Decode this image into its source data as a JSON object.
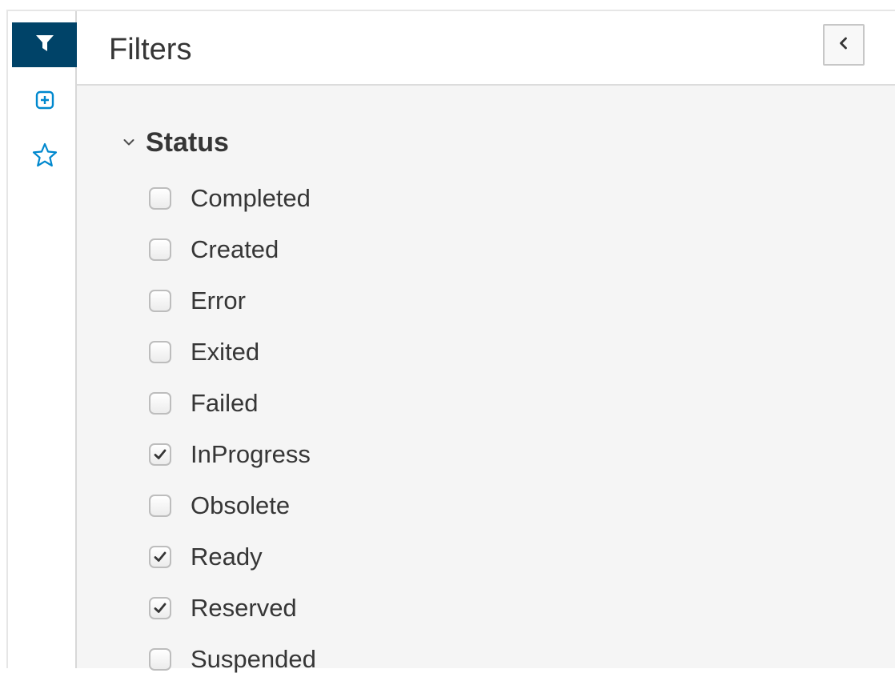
{
  "icons": {
    "rail": [
      "filter-icon",
      "add-filter-icon",
      "star-icon"
    ],
    "collapse": "chevron-left-icon",
    "section": "chevron-down-icon",
    "checkbox_check": "checkmark-icon"
  },
  "colors": {
    "active_rail": "#004368",
    "link_blue": "#0088ce",
    "text": "#363636"
  },
  "panel": {
    "title": "Filters"
  },
  "status_filter": {
    "title": "Status",
    "expanded": true,
    "options": [
      {
        "label": "Completed",
        "checked": false
      },
      {
        "label": "Created",
        "checked": false
      },
      {
        "label": "Error",
        "checked": false
      },
      {
        "label": "Exited",
        "checked": false
      },
      {
        "label": "Failed",
        "checked": false
      },
      {
        "label": "InProgress",
        "checked": true
      },
      {
        "label": "Obsolete",
        "checked": false
      },
      {
        "label": "Ready",
        "checked": true
      },
      {
        "label": "Reserved",
        "checked": true
      },
      {
        "label": "Suspended",
        "checked": false
      }
    ]
  }
}
